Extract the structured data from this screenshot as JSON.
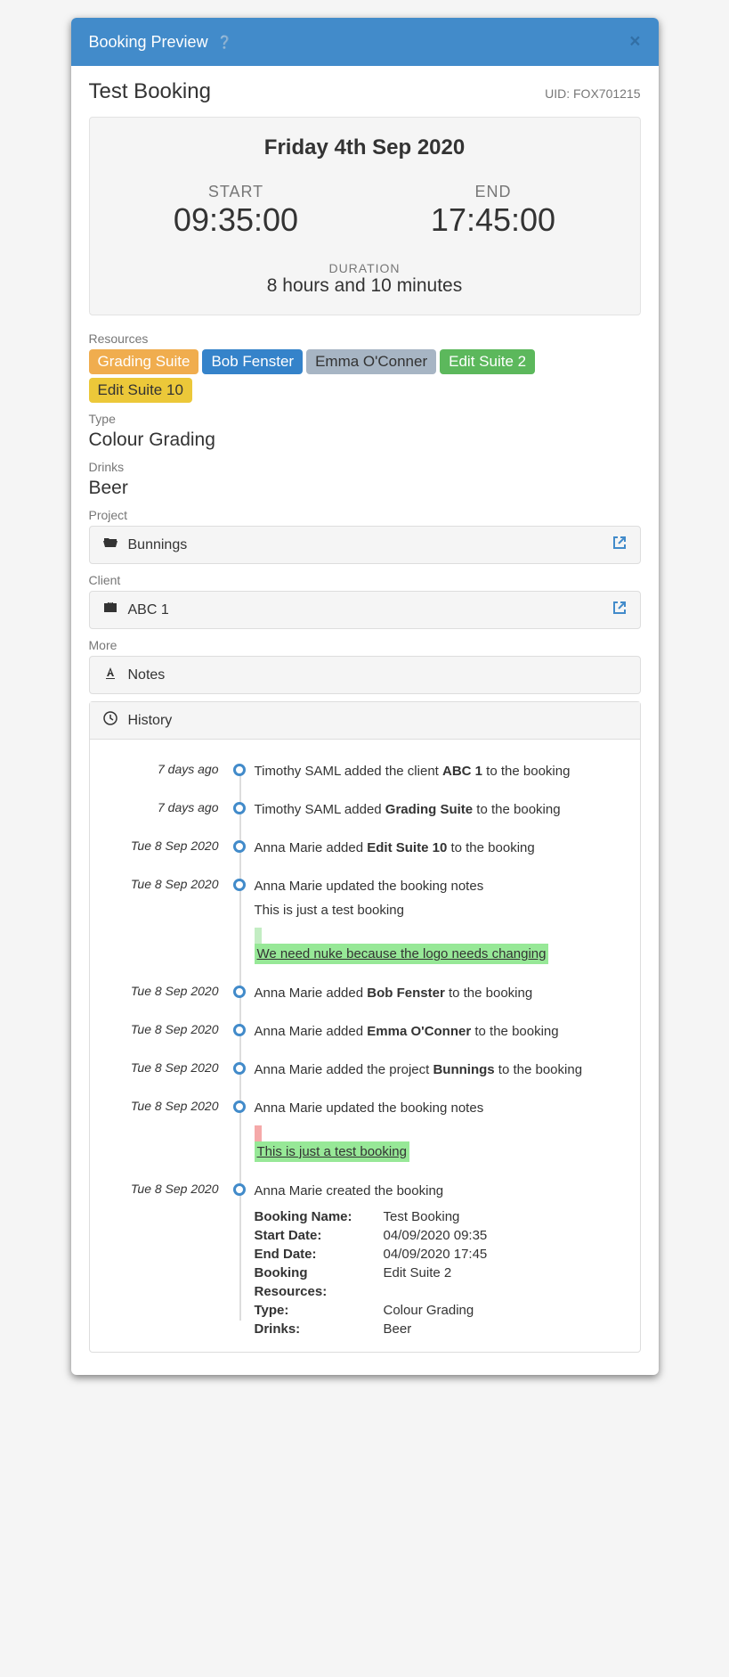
{
  "header": {
    "title": "Booking Preview"
  },
  "booking": {
    "name": "Test Booking",
    "uid": "UID: FOX701215"
  },
  "schedule": {
    "date": "Friday 4th Sep 2020",
    "start_label": "START",
    "start_time": "09:35:00",
    "end_label": "END",
    "end_time": "17:45:00",
    "duration_label": "DURATION",
    "duration_value": "8 hours and 10 minutes"
  },
  "resources": {
    "label": "Resources",
    "items": [
      "Grading Suite",
      "Bob Fenster",
      "Emma O'Conner",
      "Edit Suite 2",
      "Edit Suite 10"
    ]
  },
  "type": {
    "label": "Type",
    "value": "Colour Grading"
  },
  "drinks": {
    "label": "Drinks",
    "value": "Beer"
  },
  "project": {
    "label": "Project",
    "value": "Bunnings"
  },
  "client": {
    "label": "Client",
    "value": "ABC 1"
  },
  "more": {
    "label": "More"
  },
  "notes": {
    "label": "Notes"
  },
  "history": {
    "label": "History",
    "items": [
      {
        "time": "7 days ago",
        "text_pre": "Timothy SAML added the client ",
        "bold": "ABC 1",
        "text_post": " to the booking"
      },
      {
        "time": "7 days ago",
        "text_pre": "Timothy SAML added ",
        "bold": "Grading Suite",
        "text_post": " to the booking"
      },
      {
        "time": "Tue 8 Sep 2020",
        "text_pre": "Anna Marie added ",
        "bold": "Edit Suite 10",
        "text_post": " to the booking"
      },
      {
        "time": "Tue 8 Sep 2020",
        "text_pre": "Anna Marie updated the booking notes",
        "bold": "",
        "text_post": "",
        "diff_plain": "This is just a test booking",
        "diff_add": "We need nuke because the logo needs changing"
      },
      {
        "time": "Tue 8 Sep 2020",
        "text_pre": "Anna Marie added ",
        "bold": "Bob Fenster",
        "text_post": " to the booking"
      },
      {
        "time": "Tue 8 Sep 2020",
        "text_pre": "Anna Marie added ",
        "bold": "Emma O'Conner",
        "text_post": " to the booking"
      },
      {
        "time": "Tue 8 Sep 2020",
        "text_pre": "Anna Marie added the project ",
        "bold": "Bunnings",
        "text_post": " to the booking"
      },
      {
        "time": "Tue 8 Sep 2020",
        "text_pre": "Anna Marie updated the booking notes",
        "bold": "",
        "text_post": "",
        "diff_del": true,
        "diff_add": "This is just a test booking"
      },
      {
        "time": "Tue 8 Sep 2020",
        "text_pre": "Anna Marie created the booking",
        "bold": "",
        "text_post": "",
        "details": [
          {
            "k": "Booking Name:",
            "v": "Test Booking"
          },
          {
            "k": "Start Date:",
            "v": "04/09/2020 09:35"
          },
          {
            "k": "End Date:",
            "v": "04/09/2020 17:45"
          },
          {
            "k": "Booking Resources:",
            "v": "Edit Suite 2"
          },
          {
            "k": "Type:",
            "v": "Colour Grading"
          },
          {
            "k": "Drinks:",
            "v": "Beer"
          }
        ]
      }
    ]
  }
}
